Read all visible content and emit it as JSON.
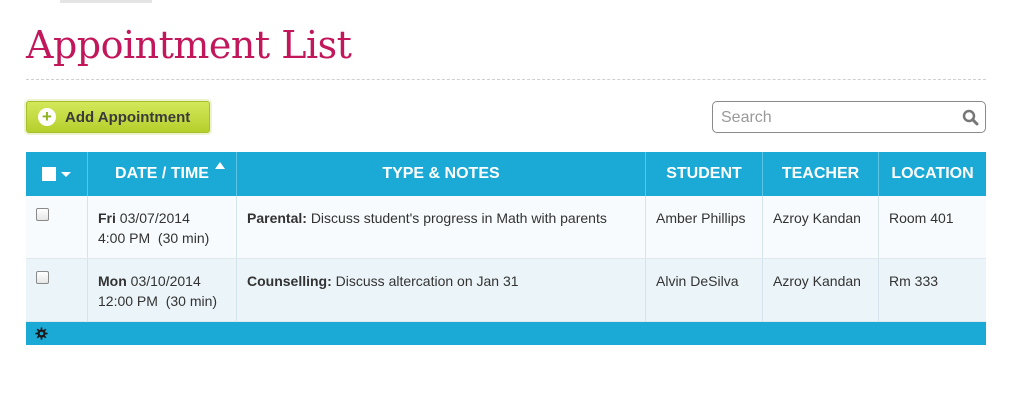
{
  "page": {
    "title": "Appointment List"
  },
  "toolbar": {
    "add_label": "Add Appointment",
    "add_icon": "plus-circle-icon"
  },
  "search": {
    "placeholder": "Search",
    "value": "",
    "icon": "magnifier-icon"
  },
  "table": {
    "columns": [
      {
        "label": "DATE / TIME",
        "sorted": "ascending"
      },
      {
        "label": "TYPE & NOTES"
      },
      {
        "label": "STUDENT"
      },
      {
        "label": "TEACHER"
      },
      {
        "label": "LOCATION"
      }
    ],
    "rows": [
      {
        "day": "Fri",
        "date": "03/07/2014",
        "time": "4:00 PM",
        "duration": "(30 min)",
        "type": "Parental:",
        "notes": "Discuss student's progress in Math with parents",
        "student": "Amber Phillips",
        "teacher": "Azroy Kandan",
        "location": "Room 401"
      },
      {
        "day": "Mon",
        "date": "03/10/2014",
        "time": "12:00 PM",
        "duration": "(30 min)",
        "type": "Counselling:",
        "notes": "Discuss altercation on Jan 31",
        "student": "Alvin DeSilva",
        "teacher": "Azroy Kandan",
        "location": "Rm 333"
      }
    ]
  },
  "footer": {
    "icon": "gear-icon"
  },
  "colors": {
    "title": "#c2185b",
    "header": "#1ba9d6",
    "add_button": "#c4dc3c"
  }
}
